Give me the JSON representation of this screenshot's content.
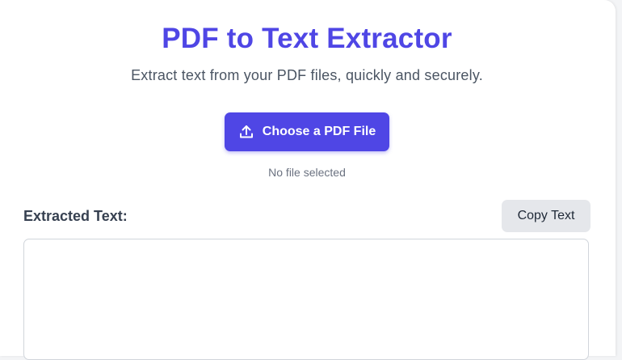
{
  "header": {
    "title": "PDF to Text Extractor",
    "subtitle": "Extract text from your PDF files, quickly and securely."
  },
  "upload": {
    "button_label": "Choose a PDF File",
    "icon": "upload-icon",
    "status": "No file selected"
  },
  "output": {
    "label": "Extracted Text:",
    "copy_label": "Copy Text",
    "value": ""
  },
  "colors": {
    "accent": "#4f46e5",
    "secondary_button": "#e5e7eb",
    "heading_text": "#374151",
    "muted_text": "#6b7280"
  }
}
